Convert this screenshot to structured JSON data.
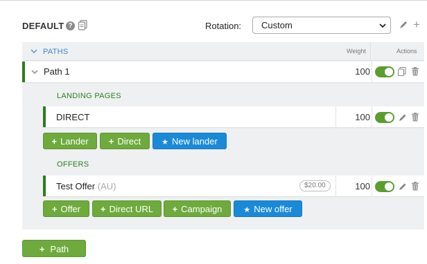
{
  "header": {
    "title": "DEFAULT",
    "help_icon_glyph": "?",
    "rotation_label": "Rotation:",
    "rotation_value": "Custom",
    "plus_glyph": "+"
  },
  "table": {
    "paths_label": "PATHS",
    "weight_label": "Weight",
    "actions_label": "Actions"
  },
  "path": {
    "name": "Path 1",
    "weight": "100",
    "enabled": true
  },
  "landing_pages": {
    "section_label": "LANDING PAGES",
    "items": [
      {
        "name": "DIRECT",
        "weight": "100",
        "enabled": true
      }
    ],
    "buttons": {
      "lander": "Lander",
      "direct": "Direct",
      "new_lander": "New lander"
    }
  },
  "offers": {
    "section_label": "OFFERS",
    "items": [
      {
        "name": "Test Offer",
        "suffix": "(AU)",
        "price": "$20.00",
        "weight": "100",
        "enabled": true
      }
    ],
    "buttons": {
      "offer": "Offer",
      "direct_url": "Direct URL",
      "campaign": "Campaign",
      "new_offer": "New offer"
    }
  },
  "footer": {
    "add_path": "Path"
  },
  "glyphs": {
    "plus": "+",
    "star": "★"
  },
  "colors": {
    "accent_green": "#6eaa3c",
    "accent_blue": "#1a8ad8",
    "row_marker": "#2e7d1f",
    "section_text": "#2e7d1f",
    "paths_text": "#3a86c8"
  },
  "icons": [
    "help-icon",
    "copy-icon",
    "pencil-icon",
    "plus-icon",
    "chevron-down-icon",
    "trash-icon",
    "star-icon"
  ]
}
